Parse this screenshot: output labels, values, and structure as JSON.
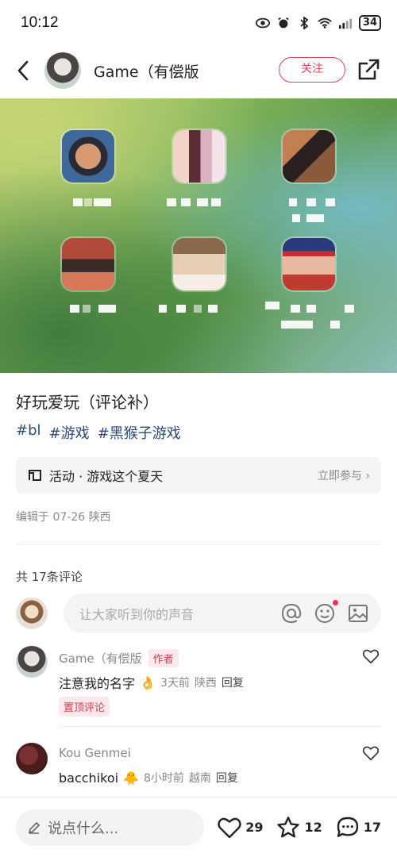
{
  "status_bar": {
    "time": "10:12",
    "battery": "34"
  },
  "header": {
    "author": "Game（有偿版",
    "follow_label": "关注"
  },
  "post": {
    "title": "好玩爱玩（评论补）",
    "tags": [
      "#bl",
      "#游戏",
      "#黑猴子游戏"
    ],
    "activity": {
      "label": "活动 · 游戏这个夏天",
      "join_label": "立即参与 ›"
    },
    "edited": "编辑于 07-26 陕西"
  },
  "comments_section": {
    "count_label": "共 17条评论",
    "input_placeholder": "让大家听到你的声音"
  },
  "comments": [
    {
      "author": "Game（有偿版",
      "badge": "作者",
      "text": "注意我的名字",
      "emoji": "👌",
      "time": "3天前",
      "location": "陕西",
      "reply": "回复",
      "pinned": "置顶评论"
    },
    {
      "author": "Kou Genmei",
      "text": "bacchikoi",
      "emoji": "🐥",
      "time": "8小时前",
      "location": "越南",
      "reply": "回复"
    }
  ],
  "bottom_bar": {
    "say_placeholder": "说点什么...",
    "likes": "29",
    "stars": "12",
    "comments": "17"
  },
  "colors": {
    "accent": "#e04055",
    "tag": "#2c4a7a",
    "muted": "#888888"
  }
}
